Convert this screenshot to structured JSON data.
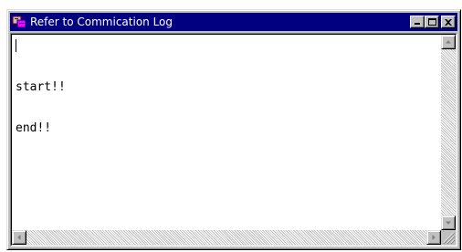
{
  "window": {
    "title": "Refer to Commication Log",
    "icon": "app-log-icon"
  },
  "caption_buttons": {
    "minimize": "minimize-icon",
    "maximize": "maximize-icon",
    "close": "close-icon"
  },
  "log": {
    "lines": [
      "start!!",
      "end!!"
    ]
  },
  "colors": {
    "titlebar": "#000080",
    "face": "#c0c0c0",
    "text_area": "#ffffff"
  }
}
